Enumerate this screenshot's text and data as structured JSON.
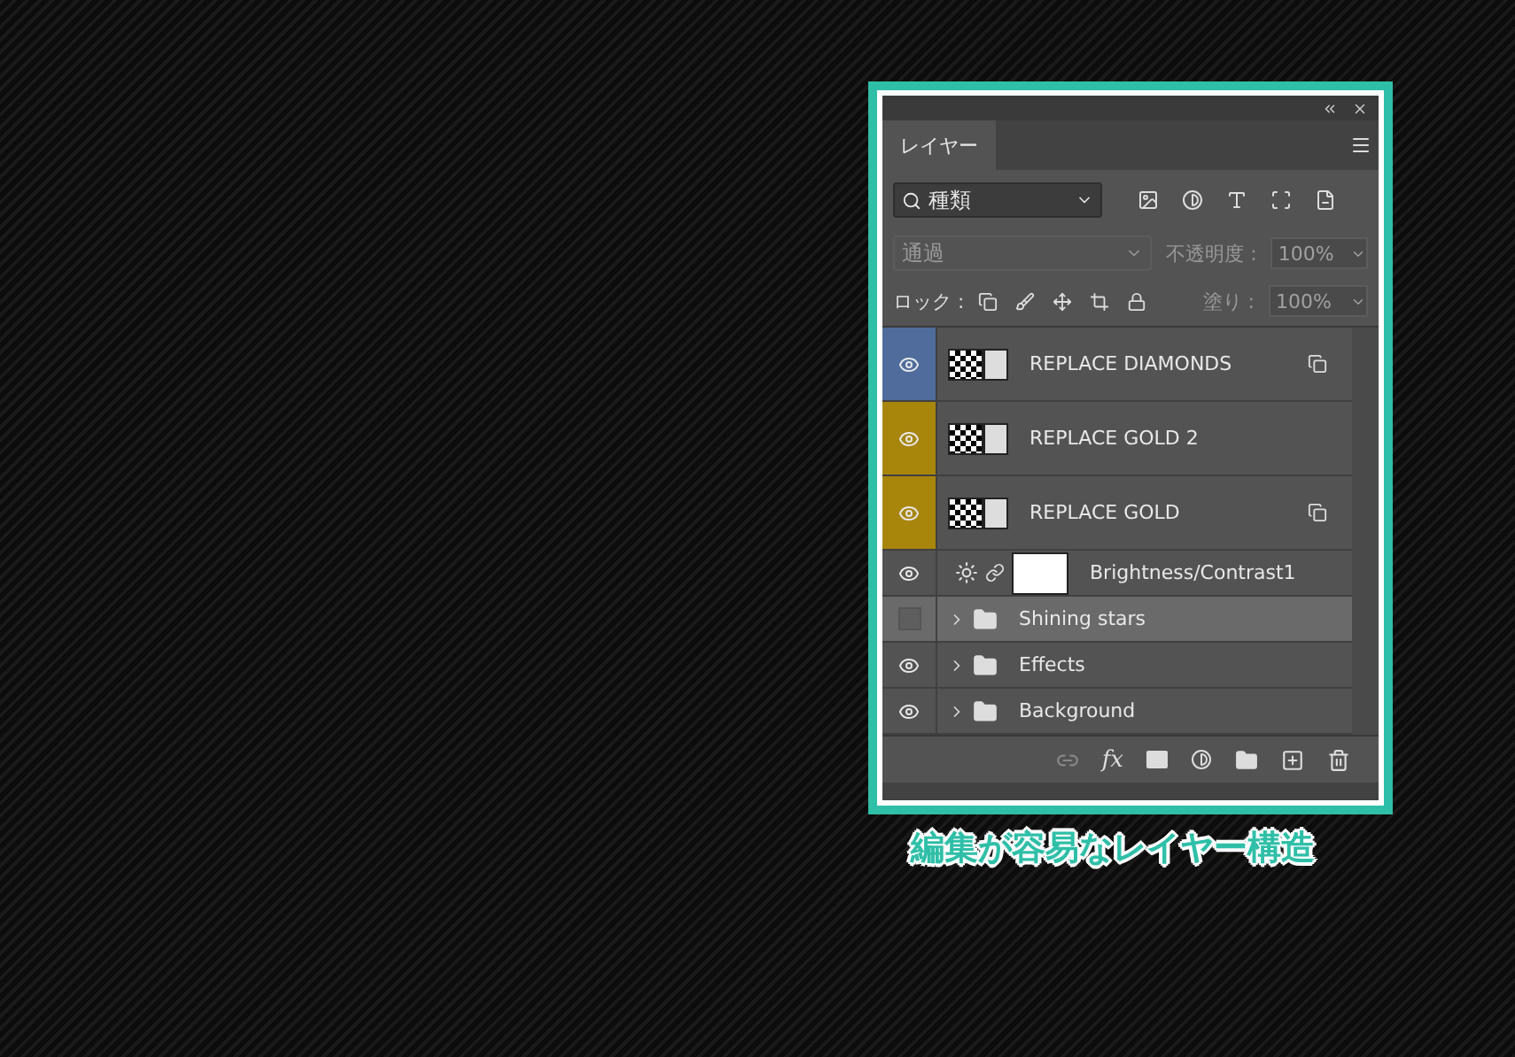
{
  "panel": {
    "tab": {
      "label": "レイヤー",
      "selected": true
    },
    "filter": {
      "value": "種類"
    },
    "blend": {
      "value": "通過",
      "disabled": true
    },
    "opacity": {
      "label": "不透明度 :",
      "value": "100%",
      "disabled": true
    },
    "lock": {
      "label": "ロック :"
    },
    "fill": {
      "label": "塗り :",
      "value": "100%",
      "disabled": true
    },
    "layers": [
      {
        "kind": "smart",
        "name": "REPLACE DIAMONDS",
        "visible": true,
        "color": "#4f6c9c",
        "linked": true,
        "selected": false
      },
      {
        "kind": "smart",
        "name": "REPLACE GOLD 2",
        "visible": true,
        "color": "#a8860c",
        "linked": false,
        "selected": false
      },
      {
        "kind": "smart",
        "name": "REPLACE GOLD",
        "visible": true,
        "color": "#a8860c",
        "linked": true,
        "selected": false
      },
      {
        "kind": "adjustment",
        "name": "Brightness/Contrast1",
        "visible": true,
        "selected": false
      },
      {
        "kind": "group",
        "name": "Shining stars",
        "visible": false,
        "selected": true
      },
      {
        "kind": "group",
        "name": "Effects",
        "visible": true,
        "selected": false
      },
      {
        "kind": "group",
        "name": "Background",
        "visible": true,
        "selected": false
      }
    ]
  },
  "footer": {
    "fx": "fx"
  },
  "caption": "編集が容易なレイヤー構造"
}
